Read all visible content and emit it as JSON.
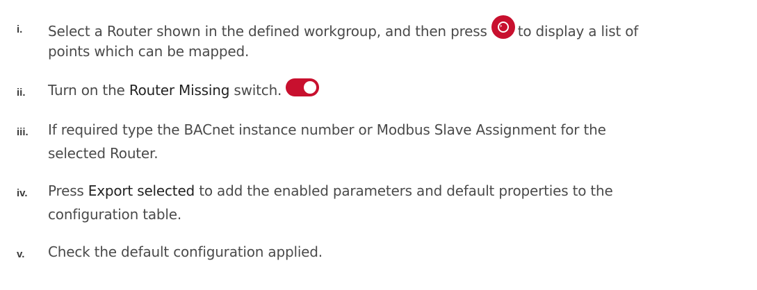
{
  "steps": [
    {
      "number": "i.",
      "text_before_icon": "Select a Router shown in the defined workgroup, and then press",
      "text_after_icon": "to display a list of",
      "line2": "points which can be mapped.",
      "icon": "circle-chevron-right-icon"
    },
    {
      "number": "ii.",
      "text_before": "Turn on the ",
      "bold": "Router Missing",
      "text_after": " switch.",
      "icon": "toggle-switch-on-icon"
    },
    {
      "number": "iii.",
      "line1": "If required type the BACnet instance number or Modbus Slave Assignment for the",
      "line2": "selected Router."
    },
    {
      "number": "iv.",
      "text_before": "Press ",
      "bold": "Export selected",
      "text_after": " to add the enabled parameters and default properties to the",
      "line2": "configuration table."
    },
    {
      "number": "v.",
      "line1": "Check the default configuration applied."
    }
  ],
  "colors": {
    "accent": "#c8102e",
    "text": "#4a4a4a"
  }
}
